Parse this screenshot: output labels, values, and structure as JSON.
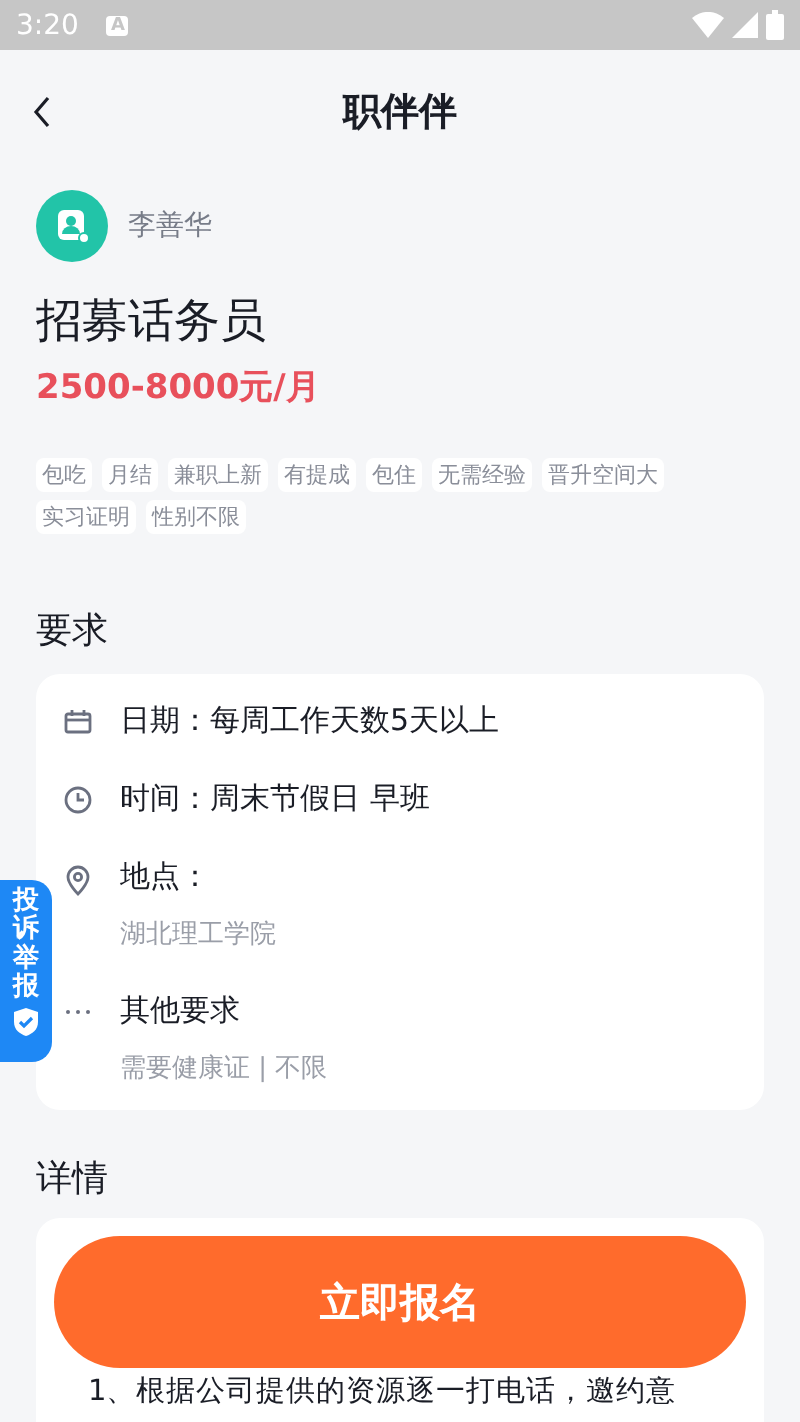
{
  "status_bar": {
    "time": "3:20",
    "notification": "A"
  },
  "header": {
    "title": "职伴伴"
  },
  "publisher": {
    "name": "李善华"
  },
  "job": {
    "title": "招募话务员",
    "salary": "2500-8000元/月"
  },
  "tags": [
    "包吃",
    "月结",
    "兼职上新",
    "有提成",
    "包住",
    "无需经验",
    "晋升空间大",
    "实习证明",
    "性别不限"
  ],
  "requirements": {
    "heading": "要求",
    "items": [
      {
        "kind": "date",
        "label": "日期：每周工作天数5天以上"
      },
      {
        "kind": "time",
        "label": "时间：周末节假日 早班"
      },
      {
        "kind": "location",
        "label": "地点：",
        "detail": "湖北理工学院"
      },
      {
        "kind": "other",
        "label": "其他要求",
        "detail": "需要健康证 | 不限"
      }
    ]
  },
  "report_tab": {
    "label": "投诉举报"
  },
  "details": {
    "heading": "详情",
    "text": "1、根据公司提供的资源逐一打电话，邀约意"
  },
  "apply_button": {
    "label": "立即报名"
  }
}
